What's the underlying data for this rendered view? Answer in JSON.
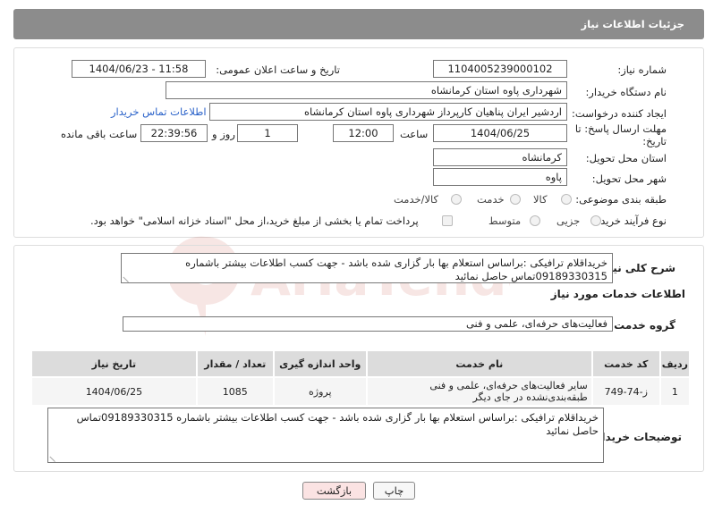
{
  "header": {
    "title": "جزئیات اطلاعات نیاز"
  },
  "info": {
    "need_number_label": "شماره نیاز:",
    "need_number": "1104005239000102",
    "announce_label": "تاریخ و ساعت اعلان عمومی:",
    "announce_value": "1404/06/23 - 11:58",
    "buyer_org_label": "نام دستگاه خریدار:",
    "buyer_org": "شهرداری پاوه استان کرمانشاه",
    "creator_label": "ایجاد کننده درخواست:",
    "creator": "اردشیر ایران پناهیان کارپرداز شهرداری پاوه استان کرمانشاه",
    "contact_link": "اطلاعات تماس خریدار",
    "deadline_label_line1": "مهلت ارسال پاسخ: تا",
    "deadline_label_line2": "تاریخ:",
    "deadline_date": "1404/06/25",
    "time_label": "ساعت",
    "deadline_time": "12:00",
    "days_value": "1",
    "days_label": "روز و",
    "remaining_time": "22:39:56",
    "remaining_label": "ساعت باقی مانده",
    "province_label": "استان محل تحویل:",
    "province": "کرمانشاه",
    "city_label": "شهر محل تحویل:",
    "city": "پاوه",
    "category_label": "طبقه بندی موضوعی:",
    "category_options": [
      "کالا",
      "خدمت",
      "کالا/خدمت"
    ],
    "process_label": "نوع فرآیند خرید :",
    "process_options": [
      "جزیی",
      "متوسط"
    ],
    "payment_note": "پرداخت تمام یا بخشی از مبلغ خرید،از محل \"اسناد خزانه اسلامی\" خواهد بود."
  },
  "details": {
    "summary_label": "شرح کلی نیاز:",
    "summary": "خریداقلام ترافیکی :براساس استعلام بها بار گزاری شده باشد - جهت کسب اطلاعات بیشتر باشماره 09189330315تماس حاصل نمائید",
    "services_title": "اطلاعات خدمات مورد نیاز",
    "service_group_label": "گروه خدمت:",
    "service_group": "فعالیت‌های حرفه‌ای، علمی و فنی",
    "table": {
      "headers": [
        "ردیف",
        "کد خدمت",
        "نام خدمت",
        "واحد اندازه گیری",
        "تعداد / مقدار",
        "تاریخ نیاز"
      ],
      "rows": [
        [
          "1",
          "ز-74-749",
          "سایر فعالیت‌های حرفه‌ای، علمی و فنی طبقه‌بندی‌نشده در جای دیگر",
          "پروژه",
          "1085",
          "1404/06/25"
        ]
      ]
    },
    "buyer_notes_label": "توضیحات خریدار:",
    "buyer_notes": "خریداقلام ترافیکی :براساس استعلام بها بار گزاری شده باشد - جهت کسب اطلاعات بیشتر باشماره 09189330315تماس حاصل نمائید"
  },
  "actions": {
    "print": "چاپ",
    "back": "بازگشت"
  },
  "colors": {
    "header_bg": "#8c8c8c",
    "link": "#2a62c9",
    "back_btn_bg": "#fbe3e3",
    "watermark": "#c0392b"
  }
}
